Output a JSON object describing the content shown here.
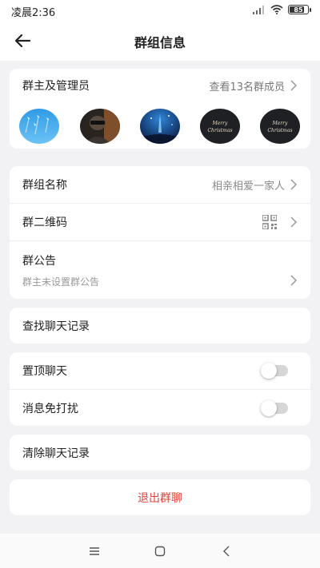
{
  "status_bar": {
    "time": "凌晨2:36",
    "battery": "85",
    "battery_level": 0.85
  },
  "header": {
    "title": "群组信息"
  },
  "members_section": {
    "title": "群主及管理员",
    "view_all": "查看13名群成员",
    "avatars": [
      {
        "name": "avatar-sky-jets"
      },
      {
        "name": "avatar-person-dark"
      },
      {
        "name": "avatar-blue-night"
      },
      {
        "name": "avatar-merry-christmas",
        "text": "Merry Christmas"
      },
      {
        "name": "avatar-merry-christmas-2",
        "text": "Merry Christmas"
      }
    ]
  },
  "group_info": {
    "name_label": "群组名称",
    "name_value": "相亲相爱一家人",
    "qrcode_label": "群二维码",
    "notice_label": "群公告",
    "notice_value": "群主未设置群公告"
  },
  "search_history": {
    "label": "查找聊天记录"
  },
  "settings": {
    "pin_label": "置顶聊天",
    "pin_on": false,
    "mute_label": "消息免打扰",
    "mute_on": false
  },
  "clear_history": {
    "label": "清除聊天记录"
  },
  "exit": {
    "label": "退出群聊",
    "color": "#e0453b"
  },
  "navbar": {
    "icons": [
      "menu-icon",
      "home-icon",
      "back-icon"
    ]
  }
}
